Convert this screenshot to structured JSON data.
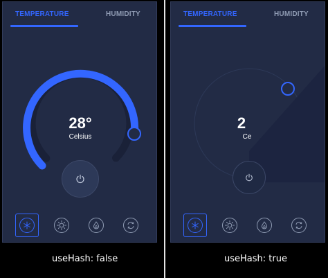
{
  "tabs": {
    "temperature": "TEMPERATURE",
    "humidity": "HUMIDITY"
  },
  "left_panel": {
    "temperature": "28°",
    "unit": "Celsius",
    "caption": "useHash: false",
    "dial_level_fraction": 0.78
  },
  "right_panel": {
    "temperature_partial": "2",
    "unit_partial": "Ce",
    "caption": "useHash: true"
  },
  "modes": [
    "snowflake-icon",
    "sun-icon",
    "flame-icon",
    "refresh-icon"
  ],
  "colors": {
    "accent": "#3366ff",
    "panel_bg": "#222b45",
    "muted": "#8f9bb3",
    "track": "#1a2138"
  }
}
